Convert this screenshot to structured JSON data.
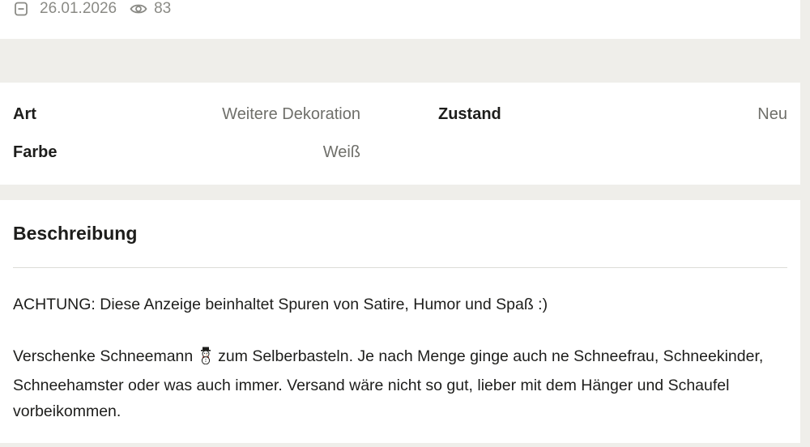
{
  "meta": {
    "calendar_icon": "calendar-icon",
    "date": "26.01.2026",
    "views_icon": "eye-icon",
    "views": "83"
  },
  "details": {
    "art_label": "Art",
    "art_value": "Weitere Dekoration",
    "zustand_label": "Zustand",
    "zustand_value": "Neu",
    "farbe_label": "Farbe",
    "farbe_value": "Weiß"
  },
  "description": {
    "title": "Beschreibung",
    "paragraph1": "ACHTUNG: Diese Anzeige beinhaltet Spuren von Satire, Humor und Spaß :)",
    "paragraph2_before": "Verschenke Schneemann",
    "snowman_icon": "snowman-emoji-icon",
    "paragraph2_after": "zum Selberbasteln. Je nach Menge ginge auch ne Schneefrau, Schneekinder, Schneehamster oder was auch immer. Versand wäre nicht so gut, lieber mit dem Hänger und Schaufel vorbeikommen."
  },
  "colors": {
    "page_background": "#efeeea",
    "card_background": "#ffffff",
    "text_primary": "#1d1d1b",
    "text_muted": "#6f6f6a",
    "meta_text": "#8a8a85",
    "divider": "#dcdcd7"
  }
}
